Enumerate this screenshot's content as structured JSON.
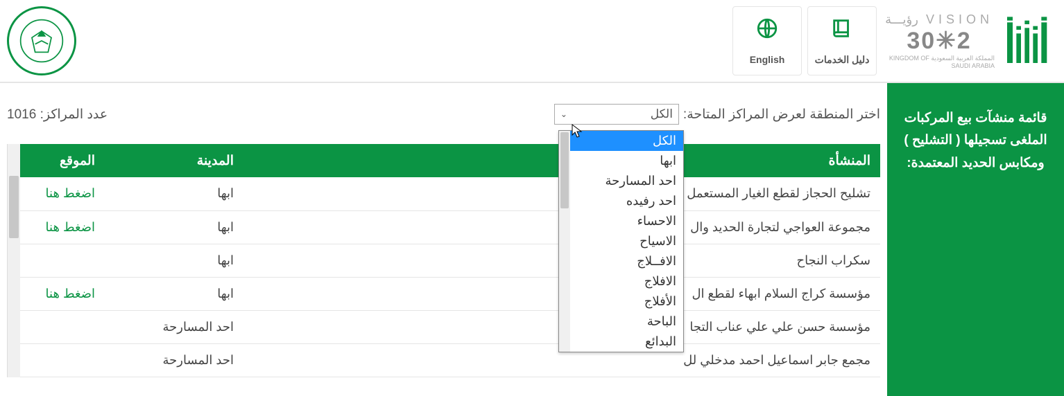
{
  "header": {
    "nav": {
      "services": "دليل الخدمات",
      "english": "English"
    },
    "vision": {
      "top": "VISION رؤيـــة",
      "mid": "2✳30",
      "bot": "المملكة العربية السعودية  KINGDOM OF SAUDI ARABIA"
    }
  },
  "sidebar": {
    "title": "قائمة منشآت بيع المركبات الملغى تسجيلها ( التشليح ) ومكابس الحديد المعتمدة:"
  },
  "filter": {
    "label": "اختر المنطقة لعرض المراكز المتاحة:",
    "selected": "الكل",
    "count_label": "عدد المراكز:",
    "count_value": "1016",
    "options": [
      "الكل",
      "ابها",
      "احد المسارحة",
      "احد رفيده",
      "الاحساء",
      "الاسياح",
      "الافــلاج",
      "الافلاج",
      "الأفلاج",
      "الباحة",
      "البدائع"
    ]
  },
  "table": {
    "headers": {
      "est": "المنشأة",
      "city": "المدينة",
      "loc": "الموقع"
    },
    "link_text": "اضغط هنا",
    "rows": [
      {
        "est": "تشليح الحجاز لقطع الغيار المستعمل",
        "city": "ابها",
        "loc": true
      },
      {
        "est": "مجموعة العواجي لتجارة الحديد وال",
        "city": "ابها",
        "loc": true
      },
      {
        "est": "سكراب النجاح",
        "city": "ابها",
        "loc": false
      },
      {
        "est": "مؤسسة كراج السلام ابهاء لقطع ال",
        "city": "ابها",
        "loc": true
      },
      {
        "est": "مؤسسة حسن علي علي عناب التجا",
        "city": "احد المسارحة",
        "loc": false
      },
      {
        "est": "مجمع جابر اسماعيل احمد مدخلي لل",
        "city": "احد المسارحة",
        "loc": false
      }
    ]
  }
}
